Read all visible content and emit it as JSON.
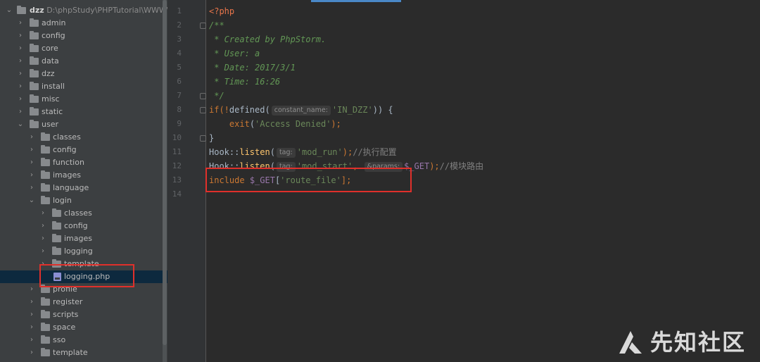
{
  "project_tree": {
    "root": {
      "name": "dzz",
      "path": "D:\\phpStudy\\PHPTutorial\\WWW\\dzz"
    },
    "items": [
      {
        "label": "admin"
      },
      {
        "label": "config"
      },
      {
        "label": "core"
      },
      {
        "label": "data"
      },
      {
        "label": "dzz"
      },
      {
        "label": "install"
      },
      {
        "label": "misc"
      },
      {
        "label": "static"
      },
      {
        "label": "user"
      },
      {
        "label": "classes"
      },
      {
        "label": "config"
      },
      {
        "label": "function"
      },
      {
        "label": "images"
      },
      {
        "label": "language"
      },
      {
        "label": "login"
      },
      {
        "label": "classes"
      },
      {
        "label": "config"
      },
      {
        "label": "images"
      },
      {
        "label": "logging"
      },
      {
        "label": "template"
      },
      {
        "label": "logging.php"
      },
      {
        "label": "profile"
      },
      {
        "label": "register"
      },
      {
        "label": "scripts"
      },
      {
        "label": "space"
      },
      {
        "label": "sso"
      },
      {
        "label": "template"
      }
    ]
  },
  "editor": {
    "line_numbers": [
      "1",
      "2",
      "3",
      "4",
      "5",
      "6",
      "7",
      "8",
      "9",
      "10",
      "11",
      "12",
      "13",
      "14"
    ],
    "lines": {
      "l1": "<?php",
      "l2": "/**",
      "l3": " * Created by PhpStorm.",
      "l4": " * User: a",
      "l5": " * Date: 2017/3/1",
      "l6": " * Time: 16:26",
      "l7": " */",
      "l8_a": "if(!",
      "l8_fn": "defined",
      "l8_b": "(",
      "l8_hint": "constant_name:",
      "l8_str": "'IN_DZZ'",
      "l8_c": ")) {",
      "l9_indent": "    ",
      "l9_kw": "exit",
      "l9_a": "(",
      "l9_str": "'Access Denied'",
      "l9_b": ");",
      "l10": "}",
      "l11_cls": "Hook",
      "l11_sep": "::",
      "l11_fn": "listen",
      "l11_a": "(",
      "l11_hint": "tag:",
      "l11_str": "'mod_run'",
      "l11_b": ");",
      "l11_cmt": "//执行配置",
      "l12_cls": "Hook",
      "l12_sep": "::",
      "l12_fn": "listen",
      "l12_a": "(",
      "l12_hint": "tag:",
      "l12_str": "'mod_start'",
      "l12_b": ", ",
      "l12_hint2": "&params:",
      "l12_var": "$_GET",
      "l12_c": ");",
      "l12_cmt": "//模块路由",
      "l13_kw": "include",
      "l13_sp": " ",
      "l13_var": "$_GET",
      "l13_a": "[",
      "l13_str": "'route_file'",
      "l13_b": "];"
    }
  },
  "watermark": {
    "text": "先知社区"
  },
  "colors": {
    "editor_bg": "#2b2b2b",
    "tree_bg": "#3c3f41",
    "highlight_box": "#e0302b",
    "keyword": "#cc7832",
    "string": "#6a8759",
    "doc_comment": "#629755"
  }
}
